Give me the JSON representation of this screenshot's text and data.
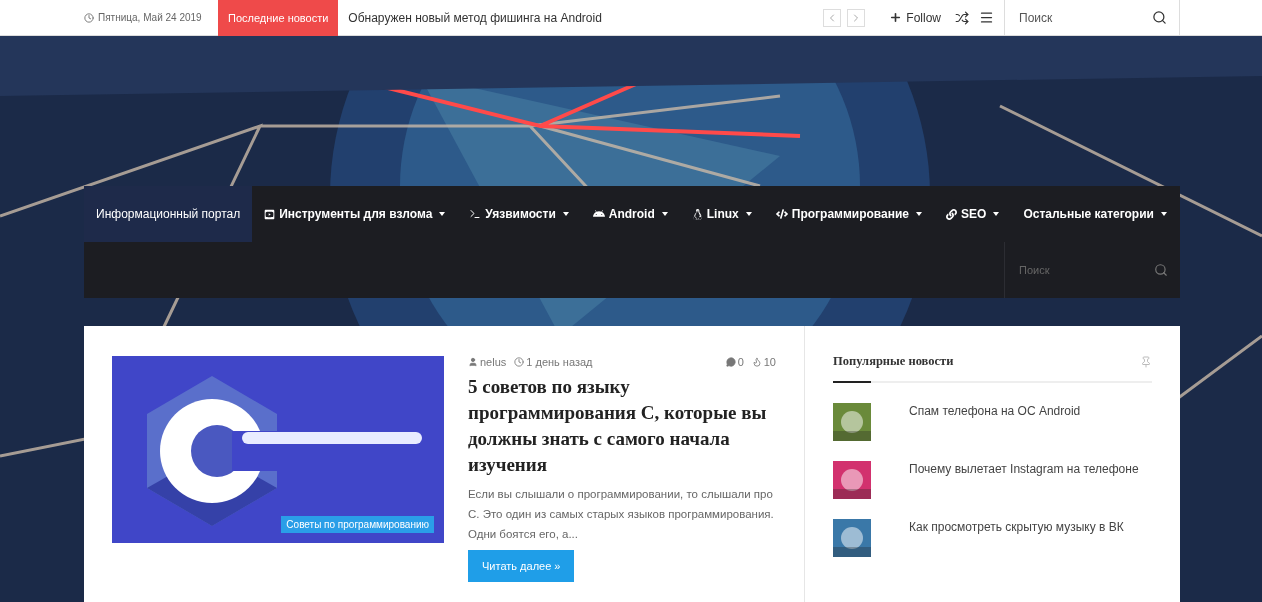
{
  "top_bar": {
    "date": "Пятница, Май 24 2019",
    "breaking_label": "Последние новости",
    "breaking_headline": "Обнаружен новый метод фишинга на Android",
    "follow": "Follow",
    "search": {
      "placeholder": "Поиск"
    }
  },
  "nav": {
    "items": [
      {
        "label": "Информационный портал",
        "selected": true,
        "dropdown": false
      },
      {
        "label": "Инструменты для взлома",
        "selected": false,
        "dropdown": true
      },
      {
        "label": "Уязвимости",
        "selected": false,
        "dropdown": true
      },
      {
        "label": "Android",
        "selected": false,
        "dropdown": true
      },
      {
        "label": "Linux",
        "selected": false,
        "dropdown": true
      },
      {
        "label": "Программирование",
        "selected": false,
        "dropdown": true
      },
      {
        "label": "SEO",
        "selected": false,
        "dropdown": true
      },
      {
        "label": "Остальные категории",
        "selected": false,
        "dropdown": true
      }
    ],
    "search": {
      "placeholder": "Поиск"
    }
  },
  "article": {
    "category": "Советы по программированию",
    "author": "nelus",
    "time": "1 день назад",
    "comments": "0",
    "views": "10",
    "title": "5 советов по языку программирования С, которые вы должны знать с самого начала изучения",
    "excerpt": "Если вы слышали о программировании, то слышали про С. Это один из самых старых языков программирования. Одни боятся его, а...",
    "button": "Читать далее »"
  },
  "sidebar": {
    "title": "Популярные новости",
    "items": [
      {
        "title": "Спам телефона на ОС Android",
        "color": "#6a8a3a"
      },
      {
        "title": "Почему вылетает Instagram на телефоне",
        "color": "#d2316e"
      },
      {
        "title": "Как просмотреть скрытую музыку в ВК",
        "color": "#3a78a8"
      }
    ]
  }
}
